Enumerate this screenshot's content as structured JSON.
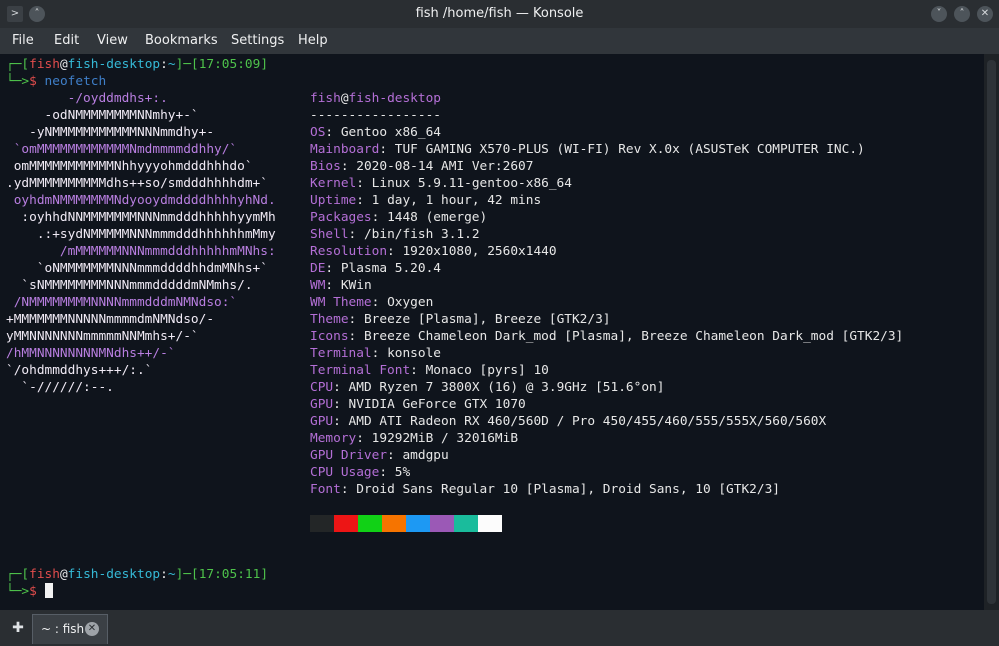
{
  "window": {
    "title": "fish /home/fish — Konsole",
    "minimize_icon": "chevron-down-icon",
    "maximize_icon": "chevron-up-icon",
    "close_icon": "close-icon"
  },
  "menubar": [
    "File",
    "Edit",
    "View",
    "Bookmarks",
    "Settings",
    "Help"
  ],
  "terminal": {
    "prompt1": {
      "corner": "┌─[",
      "user": "fish",
      "at": "@",
      "host": "fish-desktop",
      "sep": ":",
      "path": "~",
      "mid": "]─[",
      "time": "17:05:09",
      "end": "]"
    },
    "prompt1_line2": {
      "corner": "└─>",
      "dollar": "$",
      "command": " neofetch"
    },
    "ascii_art": [
      "        -/oyddmdhs+:.",
      "     -odNMMMMMMMMNNmhy+-`",
      "   -yNMMMMMMMMMMMNNNmmdhy+-",
      " `omMMMMMMMMMMMMNmdmmmmddhhy/`",
      " omMMMMMMMMMMMNhhyyyohmdddhhhdo`",
      ".ydMMMMMMMMMMdhs++so/smdddhhhhdm+`",
      " oyhdmNMMMMMMMNdyooydmddddhhhhyhNd.",
      "  :oyhhdNNMMMMMMMNNNmmdddhhhhhyymMh",
      "    .:+sydNMMMMMNNNmmmdddhhhhhhmMmy",
      "       /mMMMMMMNNNmmmdddhhhhhmMNhs:",
      "    `oNMMMMMMMNNNmmmddddhhdmMNhs+`",
      "  `sNMMMMMMMMNNNmmmdddddmNMmhs/.",
      " /NMMMMMMMMNNNNmmmdddmNMNdso:`",
      "+MMMMMMMNNNNNmmmmdmNMNdso/-",
      "yMMNNNNNNNmmmmmNNMmhs+/-`",
      "/hMMNNNNNNNNMNdhs++/-`",
      "`/ohdmmddhys+++/:.`",
      "  `-//////:--."
    ],
    "info_header": {
      "user": "fish",
      "at": "@",
      "host": "fish-desktop"
    },
    "divider": "-----------------",
    "info": [
      {
        "key": "OS",
        "value": "Gentoo x86_64"
      },
      {
        "key": "Mainboard",
        "value": "TUF GAMING X570-PLUS (WI-FI) Rev X.0x (ASUSTeK COMPUTER INC.)"
      },
      {
        "key": "Bios",
        "value": "2020-08-14 AMI Ver:2607"
      },
      {
        "key": "Kernel",
        "value": "Linux 5.9.11-gentoo-x86_64"
      },
      {
        "key": "Uptime",
        "value": "1 day, 1 hour, 42 mins"
      },
      {
        "key": "Packages",
        "value": "1448 (emerge)"
      },
      {
        "key": "Shell",
        "value": "/bin/fish 3.1.2"
      },
      {
        "key": "Resolution",
        "value": "1920x1080, 2560x1440"
      },
      {
        "key": "DE",
        "value": "Plasma 5.20.4"
      },
      {
        "key": "WM",
        "value": "KWin"
      },
      {
        "key": "WM Theme",
        "value": "Oxygen"
      },
      {
        "key": "Theme",
        "value": "Breeze [Plasma], Breeze [GTK2/3]"
      },
      {
        "key": "Icons",
        "value": "Breeze Chameleon Dark_mod [Plasma], Breeze Chameleon Dark_mod [GTK2/3]"
      },
      {
        "key": "Terminal",
        "value": "konsole"
      },
      {
        "key": "Terminal Font",
        "value": "Monaco [pyrs] 10"
      },
      {
        "key": "CPU",
        "value": "AMD Ryzen 7 3800X (16) @ 3.9GHz [51.6°on]"
      },
      {
        "key": "GPU",
        "value": "NVIDIA GeForce GTX 1070"
      },
      {
        "key": "GPU",
        "value": "AMD ATI Radeon RX 460/560D / Pro 450/455/460/555/555X/560/560X"
      },
      {
        "key": "Memory",
        "value": "19292MiB / 32016MiB"
      },
      {
        "key": "GPU Driver",
        "value": "amdgpu"
      },
      {
        "key": "CPU Usage",
        "value": "5%"
      },
      {
        "key": "Font",
        "value": "Droid Sans Regular 10 [Plasma], Droid Sans, 10 [GTK2/3]"
      }
    ],
    "palette": [
      "#232627",
      "#ed1515",
      "#11d116",
      "#f67400",
      "#1d99f3",
      "#9b59b6",
      "#1abc9c",
      "#fcfcfc"
    ],
    "prompt2": {
      "corner": "┌─[",
      "user": "fish",
      "at": "@",
      "host": "fish-desktop",
      "sep": ":",
      "path": "~",
      "mid": "]─[",
      "time": "17:05:11",
      "end": "]"
    },
    "prompt2_line2": {
      "corner": "└─>",
      "dollar": "$"
    }
  },
  "tabbar": {
    "new_tab_icon": "new-tab-icon",
    "tab_label": "~ : fish",
    "close_tab_icon": "close-icon"
  }
}
